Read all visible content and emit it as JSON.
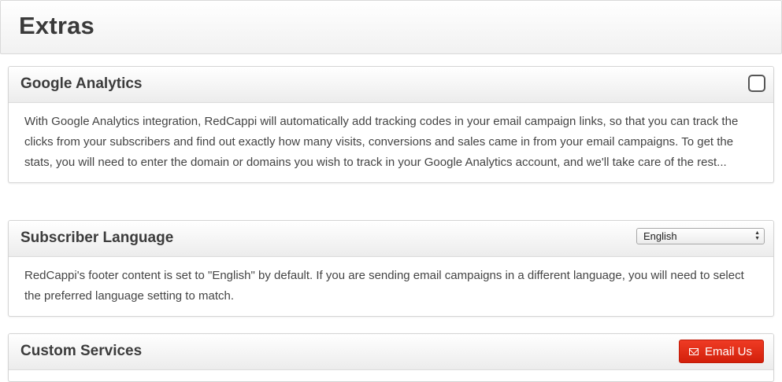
{
  "page": {
    "title": "Extras"
  },
  "panels": {
    "google_analytics": {
      "title": "Google Analytics",
      "checked": false,
      "description": "With Google Analytics integration, RedCappi will automatically add tracking codes in your email campaign links, so that you can track the clicks from your subscribers and find out exactly how many visits, conversions and sales came in from your email campaigns. To get the stats, you will need to enter the domain or domains you wish to track in your Google Analytics account, and we'll take care of the rest..."
    },
    "subscriber_language": {
      "title": "Subscriber Language",
      "selected_language": "English",
      "description": "RedCappi's footer content is set to \"English\" by default. If you are sending email campaigns in a different language, you will need to select the preferred language setting to match."
    },
    "custom_services": {
      "title": "Custom Services",
      "button_label": "Email Us",
      "button_icon": "envelope-icon",
      "button_color": "#e2301a"
    }
  }
}
